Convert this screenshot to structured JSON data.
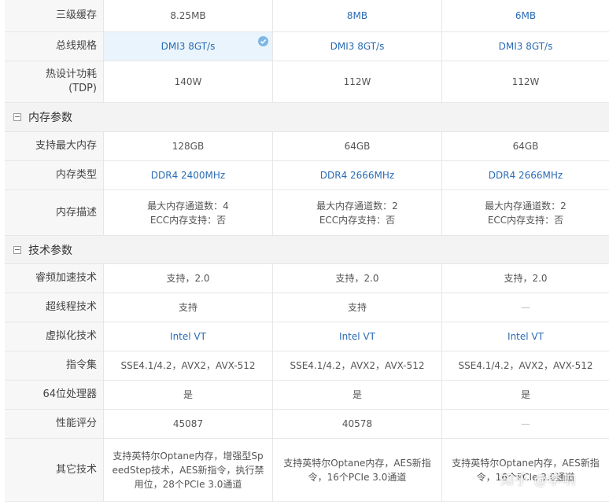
{
  "rows_top": [
    {
      "label": "三级缓存",
      "vals": [
        "8.25MB",
        "8MB",
        "6MB"
      ],
      "blue": [
        false,
        true,
        true
      ]
    },
    {
      "label": "总线规格",
      "vals": [
        "DMI3 8GT/s",
        "DMI3 8GT/s",
        "DMI3 8GT/s"
      ],
      "blue": [
        true,
        true,
        true
      ]
    },
    {
      "label1": "热设计功耗",
      "label2": "(TDP)",
      "vals": [
        "140W",
        "112W",
        "112W"
      ]
    }
  ],
  "section_memory": "内存参数",
  "rows_mem": [
    {
      "label": "支持最大内存",
      "vals": [
        "128GB",
        "64GB",
        "64GB"
      ]
    },
    {
      "label": "内存类型",
      "vals": [
        "DDR4 2400MHz",
        "DDR4 2666MHz",
        "DDR4 2666MHz"
      ]
    },
    {
      "label": "内存描述",
      "vals": [
        [
          "最大内存通道数：4",
          "ECC内存支持：否"
        ],
        [
          "最大内存通道数：2",
          "ECC内存支持：否"
        ],
        [
          "最大内存通道数：2",
          "ECC内存支持：否"
        ]
      ]
    }
  ],
  "section_tech": "技术参数",
  "rows_tech": [
    {
      "label": "睿频加速技术",
      "vals": [
        "支持，2.0",
        "支持，2.0",
        "支持，2.0"
      ]
    },
    {
      "label": "超线程技术",
      "vals": [
        "支持",
        "支持",
        "—"
      ]
    },
    {
      "label": "虚拟化技术",
      "vals": [
        "Intel VT",
        "Intel VT",
        "Intel VT"
      ]
    },
    {
      "label": "指令集",
      "vals": [
        "SSE4.1/4.2，AVX2，AVX-512",
        "SSE4.1/4.2，AVX2，AVX-512",
        "SSE4.1/4.2，AVX2，AVX-512"
      ]
    },
    {
      "label": "64位处理器",
      "vals": [
        "是",
        "是",
        "是"
      ]
    },
    {
      "label": "性能评分",
      "vals": [
        "45087",
        "40578",
        "—"
      ]
    },
    {
      "label": "其它技术",
      "vals": [
        [
          "支持英特尔Optane内存，增强型Sp",
          "eedStep技术，AES新指令，执行禁",
          "用位，28个PCIe 3.0通道"
        ],
        [
          "支持英特尔Optane内存，AES新指",
          "令，16个PCIe 3.0通道"
        ],
        [
          "支持英特尔Optane内存，AES新指",
          "令，16个PCIe 3.0通道"
        ]
      ]
    }
  ],
  "watermark": "知乎 @李响",
  "colors": {
    "blue": "#2a6bb3",
    "label_bg": "#f7f7f7",
    "highlight_bg": "#eaf4fc",
    "border": "#e6e6e6"
  },
  "icons": {
    "collapse": "minus-square-icon",
    "selected": "check-circle-icon"
  }
}
